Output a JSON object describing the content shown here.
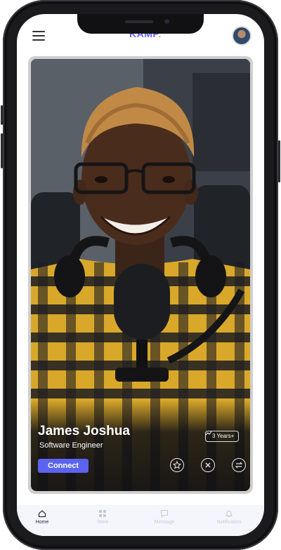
{
  "header": {
    "logo_text": "KAMP",
    "logo_dot": ".",
    "menu_icon": "hamburger-menu-icon",
    "avatar_icon": "user-avatar"
  },
  "profile": {
    "name": "James Joshua",
    "title": "Software Engineer",
    "experience": "3 Years+",
    "connect_label": "Connect"
  },
  "actions": [
    {
      "icon": "badge-star-icon"
    },
    {
      "icon": "close-icon"
    },
    {
      "icon": "swap-arrows-icon"
    }
  ],
  "tabs": [
    {
      "label": "Home",
      "icon": "home-icon",
      "active": true
    },
    {
      "label": "Store",
      "icon": "grid-icon",
      "active": false
    },
    {
      "label": "Message",
      "icon": "chat-icon",
      "active": false
    },
    {
      "label": "Notification",
      "icon": "bell-icon",
      "active": false
    }
  ],
  "colors": {
    "accent": "#5b63f0",
    "logo_dot": "#f5b21a",
    "tab_active": "#23284a",
    "tab_inactive": "#c5c8d6"
  }
}
